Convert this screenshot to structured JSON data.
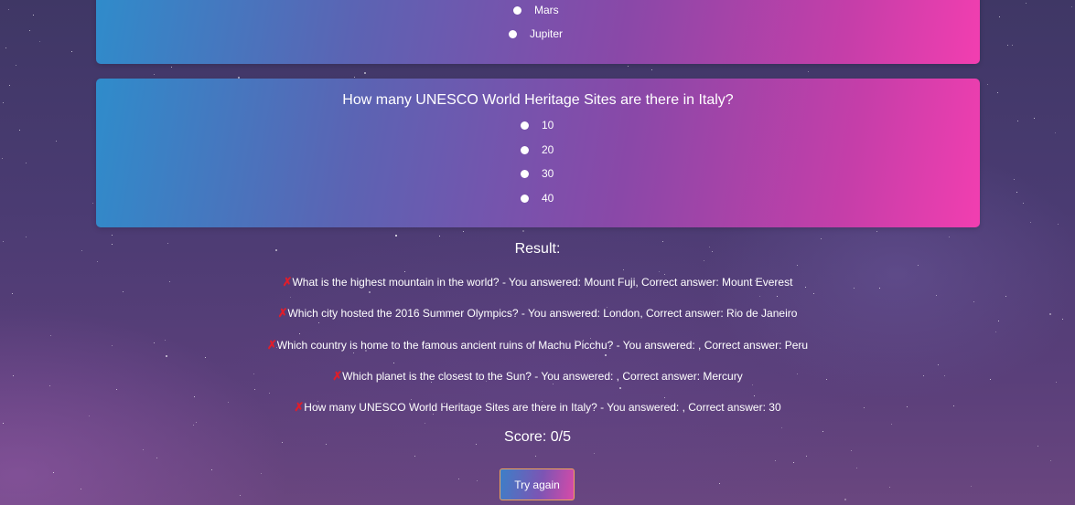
{
  "quiz": {
    "planet_question": {
      "options": [
        "Mars",
        "Jupiter"
      ]
    },
    "italy_question": {
      "text": "How many UNESCO World Heritage Sites are there in Italy?",
      "options": [
        "10",
        "20",
        "30",
        "40"
      ]
    }
  },
  "result": {
    "title": "Result:",
    "mark": "✗",
    "lines": [
      "What is the highest mountain in the world? - You answered: Mount Fuji, Correct answer: Mount Everest",
      "Which city hosted the 2016 Summer Olympics? - You answered: London, Correct answer: Rio de Janeiro",
      "Which country is home to the famous ancient ruins of Machu Picchu? - You answered: , Correct answer: Peru",
      "Which planet is the closest to the Sun? - You answered: , Correct answer: Mercury",
      "How many UNESCO World Heritage Sites are there in Italy? - You answered: , Correct answer: 30"
    ],
    "score": "Score: 0/5",
    "try_again_label": "Try again"
  },
  "colors": {
    "card_gradient_start": "#2f8ccb",
    "card_gradient_end": "#f23eb0",
    "wrong_mark": "#e11d2a",
    "button_border": "#f0a45a"
  }
}
